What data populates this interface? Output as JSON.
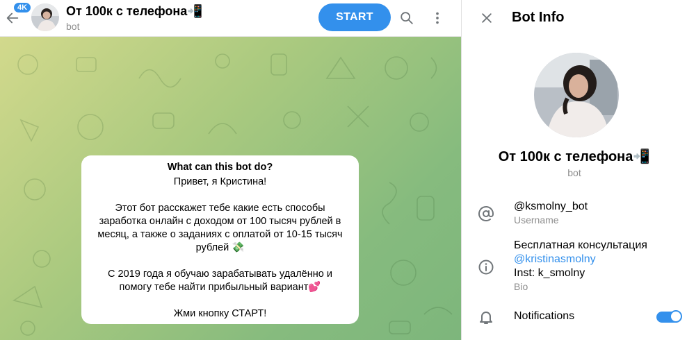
{
  "chat": {
    "unread_badge": "4K",
    "title": "От 100к с телефона📲",
    "subtitle": "bot",
    "start_label": "START"
  },
  "bot_card": {
    "heading": "What can this bot do?",
    "line1": "Привет, я Кристина!",
    "para1": "Этот бот расскажет тебе какие есть способы заработка онлайн с доходом от 100 тысяч рублей в месяц, а также о заданиях с оплатой от 10-15 тысяч рублей 💸",
    "para2": "С 2019 года я обучаю зарабатывать удалённо и помогу тебе найти прибыльный вариант💕",
    "para3": "Жми кнопку СТАРТ!"
  },
  "info": {
    "title": "Bot Info",
    "name": "От 100к с телефона📲",
    "subtitle": "bot",
    "username": "@ksmolny_bot",
    "username_label": "Username",
    "bio_line1": "Бесплатная консультация",
    "bio_link": "@kristinasmolny",
    "bio_line3": "Inst: k_smolny",
    "bio_label": "Bio",
    "notifications_label": "Notifications",
    "notifications_on": true
  },
  "colors": {
    "accent": "#3390ec",
    "muted": "#8e8e8e"
  },
  "icons": {
    "back": "arrow-left-icon",
    "search": "search-icon",
    "more": "more-vertical-icon",
    "close": "close-icon",
    "username": "at-sign-icon",
    "bio": "info-icon",
    "notifications": "bell-icon"
  }
}
